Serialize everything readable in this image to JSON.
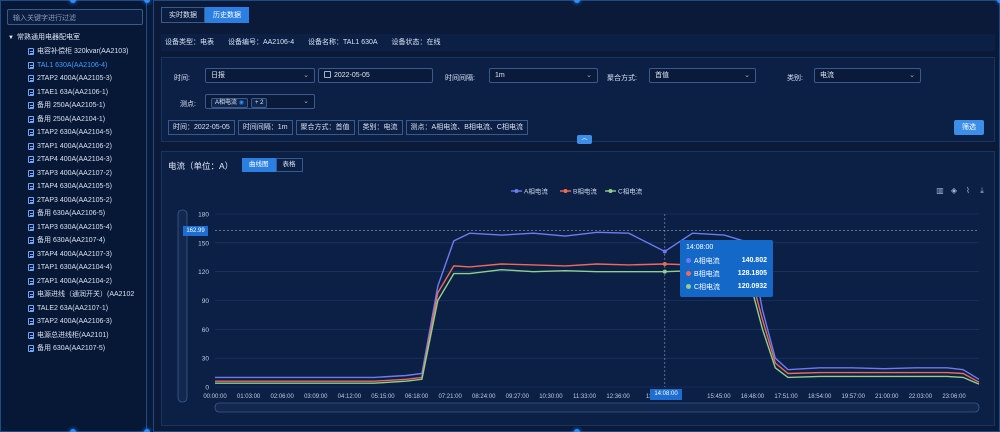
{
  "search": {
    "placeholder": "输入关键字进行过滤"
  },
  "tree": {
    "root_label": "常熟通用电器配电室",
    "items": [
      "电容补偿柜 320kvar(AA2103)",
      "TAL1 630A(AA2106-4)",
      "2TAP2 400A(AA2105-3)",
      "1TAE1 63A(AA2106-1)",
      "备用 250A(AA2105-1)",
      "备用 250A(AA2104-1)",
      "1TAP2 630A(AA2104-5)",
      "3TAP1 400A(AA2106-2)",
      "2TAP4 400A(AA2104-3)",
      "3TAP3 400A(AA2107-2)",
      "1TAP4 630A(AA2105-5)",
      "2TAP3 400A(AA2105-2)",
      "备用 630A(AA2106-5)",
      "1TAP3 630A(AA2105-4)",
      "备用 630A(AA2107-4)",
      "3TAP4 400A(AA2107-3)",
      "1TAP1 630A(AA2104-4)",
      "2TAP1 400A(AA2104-2)",
      "电源进线（通润开关）(AA2102",
      "TALE2 63A(AA2107-1)",
      "3TAP2 400A(AA2106-3)",
      "电源总进线柜(AA2101)",
      "备用 630A(AA2107-5)"
    ],
    "active_index": 1
  },
  "tabs": [
    "实时数据",
    "历史数据"
  ],
  "info": {
    "type": "设备类型：电表",
    "code": "设备编号：AA2106-4",
    "name": "设备名称：TAL1 630A",
    "state": "设备状态：在线"
  },
  "filters": {
    "time_label": "时间:",
    "time_value": "日报",
    "date_value": "2022-05-05",
    "interval_label": "时间间隔:",
    "interval_value": "1m",
    "agg_label": "聚合方式:",
    "agg_value": "首值",
    "category_label": "类别:",
    "category_value": "电流",
    "point_label": "测点:",
    "point_chip": "A相电流",
    "point_more": "+ 2"
  },
  "summary": [
    "时间：2022-05-05",
    "时间间隔：1m",
    "聚合方式：首值",
    "类别：电流",
    "测点：A相电流、B相电流、C相电流"
  ],
  "query_button": "筛选",
  "chart_title": "电流（单位：A）",
  "view_toggle": [
    "曲线图",
    "表格"
  ],
  "tooltip": {
    "time": "14:08:00",
    "rows": [
      {
        "name": "A相电流",
        "value": "140.802"
      },
      {
        "name": "B相电流",
        "value": "128.1805"
      },
      {
        "name": "C相电流",
        "value": "120.0932"
      }
    ]
  },
  "y_pointer_value": "162.99",
  "x_pointer_value": "14:08:00",
  "colors": {
    "accent": "#2b7fe0",
    "seriesA": "#6c7cf0",
    "seriesB": "#ef6a56",
    "seriesC": "#8fd08c"
  },
  "chart_data": {
    "type": "line",
    "ylim": [
      0,
      180
    ],
    "yticks": [
      0,
      30,
      60,
      90,
      120,
      150,
      180
    ],
    "xtick_labels": [
      "00:00:00",
      "01:03:00",
      "02:06:00",
      "03:09:00",
      "04:12:00",
      "05:15:00",
      "06:18:00",
      "07:21:00",
      "08:24:00",
      "09:27:00",
      "10:30:00",
      "11:33:00",
      "12:36:00",
      "13:3",
      "",
      "15:45:00",
      "16:48:00",
      "17:51:00",
      "18:54:00",
      "19:57:00",
      "21:00:00",
      "22:03:00",
      "23:06:00"
    ],
    "x_hours": [
      0,
      1,
      2,
      3,
      4,
      5,
      6,
      6.5,
      7,
      7.5,
      8,
      9,
      10,
      11,
      12,
      13,
      14.13,
      15,
      16,
      16.8,
      17.2,
      17.6,
      18,
      19,
      20,
      21,
      22,
      23,
      23.5,
      24
    ],
    "series": [
      {
        "name": "A相电流",
        "values": [
          10,
          10,
          10,
          10,
          10,
          10,
          12,
          14,
          105,
          152,
          160,
          158,
          160,
          157,
          161,
          160,
          141,
          160,
          158,
          150,
          80,
          30,
          18,
          20,
          20,
          19,
          20,
          20,
          18,
          8
        ]
      },
      {
        "name": "B相电流",
        "values": [
          6,
          6,
          6,
          6,
          6,
          6,
          8,
          10,
          98,
          126,
          125,
          128,
          127,
          126,
          128,
          127,
          128,
          127,
          126,
          120,
          70,
          25,
          14,
          15,
          15,
          15,
          15,
          15,
          14,
          5
        ]
      },
      {
        "name": "C相电流",
        "values": [
          4,
          4,
          4,
          4,
          4,
          4,
          6,
          8,
          90,
          118,
          118,
          122,
          120,
          121,
          120,
          120,
          120,
          121,
          118,
          110,
          60,
          20,
          10,
          11,
          11,
          11,
          11,
          11,
          10,
          3
        ]
      }
    ],
    "legend_position": "top-center",
    "grid": true
  }
}
